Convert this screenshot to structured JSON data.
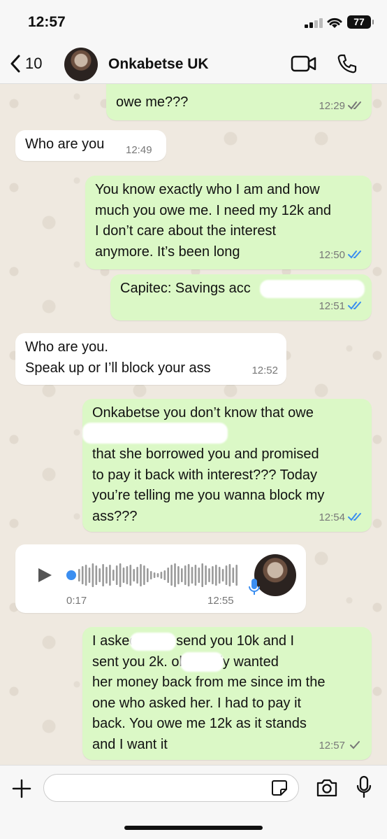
{
  "status": {
    "time": "12:57",
    "battery": "77"
  },
  "header": {
    "back_count": "10",
    "contact_name": "Onkabetse UK"
  },
  "messages": [
    {
      "dir": "out",
      "text": "owe me???",
      "time": "12:29",
      "ticks": "read"
    },
    {
      "dir": "in",
      "text": "Who are you",
      "time": "12:49"
    },
    {
      "dir": "out",
      "text": "You know exactly who I am and how\nmuch you owe me. I need my 12k and\nI don’t care about the interest\nanymore. It’s been long",
      "time": "12:50",
      "ticks": "read-blue"
    },
    {
      "dir": "out",
      "text": "Capitec: Savings acc",
      "time": "12:51",
      "ticks": "read-blue"
    },
    {
      "dir": "in",
      "text": "Who are you.\nSpeak up or I’ll block your ass",
      "time": "12:52"
    },
    {
      "dir": "out",
      "text": "Onkabetse you don’t know that owe\n                                     12 thousand rands\nthat she borrowed you and promised\nto pay it back with interest???  Today\nyou’re telling me you wanna block my\nass???",
      "time": "12:54",
      "ticks": "read-blue"
    },
    {
      "dir": "out",
      "text": "I asked          na to send you 10k and I\nsent you 2k.            obviously wanted\nher money back from me since im the\none who asked her. I had to pay it\nback. You owe me 12k as it stands\nand I want it",
      "time": "12:57",
      "ticks": "sent"
    }
  ],
  "voice_note": {
    "duration": "0:17",
    "time": "12:55"
  },
  "input": {
    "placeholder": ""
  },
  "colors": {
    "outgoing": "#dbf8c6",
    "incoming": "#ffffff",
    "read_blue": "#3b8ef0",
    "accent_green": "#25d366"
  },
  "icons": [
    "back-chevron-icon",
    "video-camera-icon",
    "phone-icon",
    "play-icon",
    "microphone-icon",
    "plus-icon",
    "sticker-icon",
    "camera-icon"
  ]
}
